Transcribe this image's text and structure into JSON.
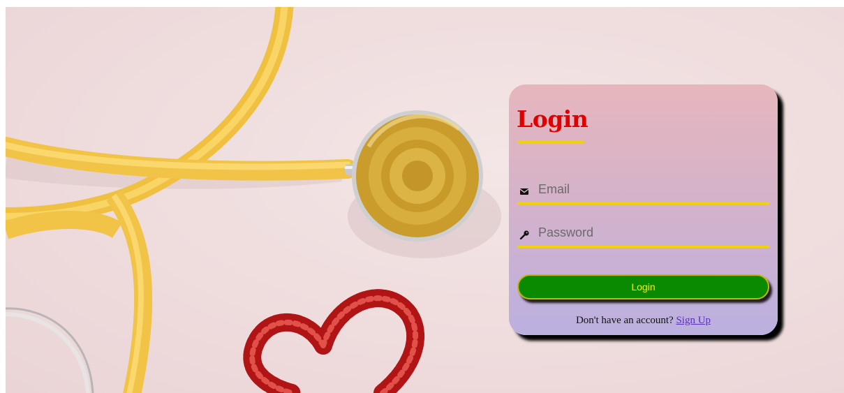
{
  "login": {
    "title": "Login",
    "email_placeholder": "Email",
    "password_placeholder": "Password",
    "submit_label": "Login",
    "signup_prompt": "Don't have an account?",
    "signup_link": "Sign Up"
  },
  "icons": {
    "email": "envelope-icon",
    "password": "key-icon"
  },
  "colors": {
    "title": "#e00000",
    "underline": "#f2d200",
    "button_bg": "#0a8a00",
    "button_text": "#ffe800",
    "link": "#5a2fb8"
  }
}
